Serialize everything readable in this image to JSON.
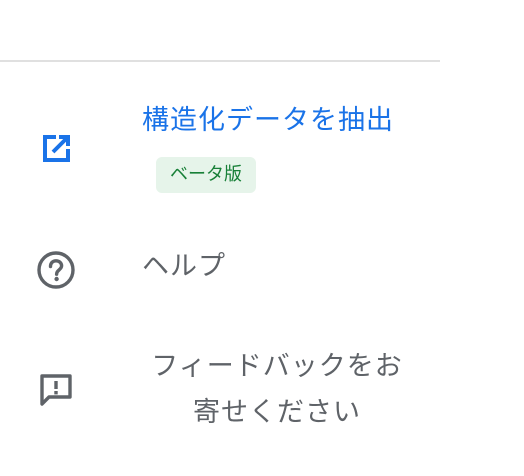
{
  "menu": {
    "items": [
      {
        "label": "構造化データを抽出",
        "badge": "ベータ版",
        "icon": "open-in-new-icon"
      },
      {
        "label": "ヘルプ",
        "icon": "help-circle-icon"
      },
      {
        "label_line1": "フィードバックをお",
        "label_line2": "寄せください",
        "icon": "feedback-icon"
      }
    ]
  },
  "colors": {
    "accent": "#1a73e8",
    "text_secondary": "#5f6368",
    "badge_bg": "#e6f4ea",
    "badge_text": "#188038",
    "divider": "#e0e0e0"
  }
}
